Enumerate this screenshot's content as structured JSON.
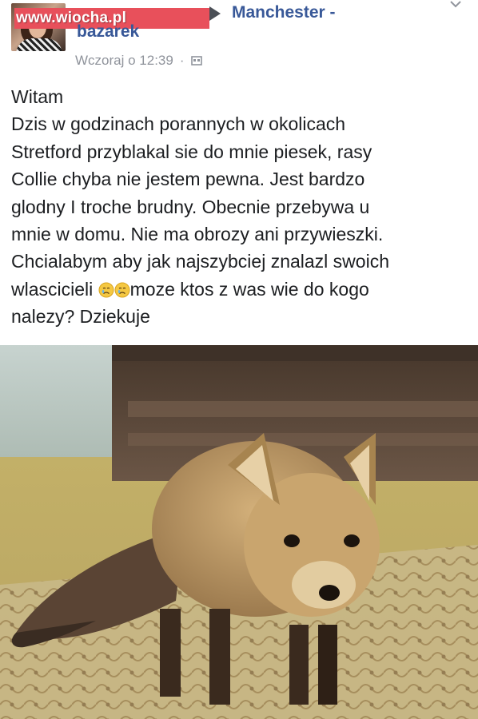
{
  "watermark": {
    "text": "www.wiocha.pl"
  },
  "post": {
    "group_name_line1": "Manchester -",
    "group_name_line2": "bazarek",
    "timestamp": "Wczoraj o 12:39",
    "separator": "·",
    "privacy_icon": "group-privacy-icon",
    "text_lines": [
      "Witam",
      "Dzis w godzinach porannych w okolicach",
      "Stretford przyblakal sie do mnie piesek,  rasy",
      "Collie chyba nie jestem pewna. Jest bardzo",
      "glodny I troche brudny. Obecnie przebywa u",
      "mnie w domu. Nie ma obrozy ani przywieszki.",
      "Chcialabym aby jak najszybciej znalazl swoich"
    ],
    "text_line_8_before_emoji": "wlascicieli ",
    "emoji": "crying-face-icon",
    "text_line_8_after_emoji": "moze ktos z was wie do kogo",
    "text_line_9": "nalezy? Dziekuje"
  },
  "colors": {
    "link": "#385898",
    "meta": "#90949c",
    "watermark_bg": "#e8505b",
    "text": "#1c1e21"
  },
  "photo": {
    "subject": "fox-photo"
  }
}
